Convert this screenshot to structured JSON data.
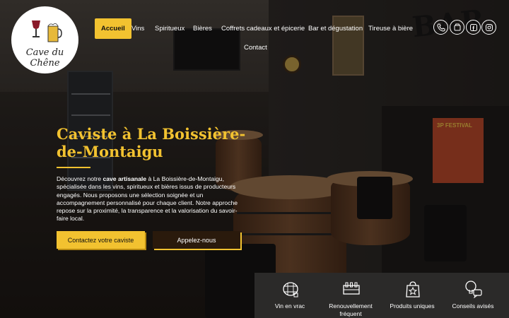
{
  "brand": {
    "name": "Cave du Chêne"
  },
  "nav": {
    "items": [
      {
        "label": "Accueil",
        "active": true
      },
      {
        "label": "Vins"
      },
      {
        "label": "Spiritueux"
      },
      {
        "label": "Bières"
      },
      {
        "label": "Coffrets cadeaux et épicerie"
      },
      {
        "label": "Bar et dégustation"
      },
      {
        "label": "Tireuse à bière"
      },
      {
        "label": "Contact"
      }
    ]
  },
  "social": [
    {
      "icon": "phone-icon"
    },
    {
      "icon": "untappd-icon"
    },
    {
      "icon": "facebook-icon"
    },
    {
      "icon": "instagram-icon"
    }
  ],
  "hero": {
    "title": "Caviste à La Boissière-de-Montaigu",
    "text_before": "Découvrez notre ",
    "text_bold": "cave artisanale",
    "text_after": " à La Boissière-de-Montaigu, spécialisée dans les vins, spiritueux et bières issus de producteurs engagés. Nous proposons une sélection soignée et un accompagnement personnalisé pour chaque client. Notre approche repose sur la proximité, la transparence et la valorisation du savoir-faire local.",
    "primary_button": "Contactez votre caviste",
    "secondary_button": "Appelez-nous"
  },
  "scene": {
    "bar_sign": "BAR",
    "festival_poster": "3P FESTIVAL"
  },
  "features": [
    {
      "icon": "barrel-icon",
      "label": "Vin en vrac"
    },
    {
      "icon": "bottles-crate-icon",
      "label": "Renouvellement fréquent"
    },
    {
      "icon": "star-bag-icon",
      "label": "Produits uniques"
    },
    {
      "icon": "advice-bubble-icon",
      "label": "Conseils avisés"
    }
  ],
  "colors": {
    "accent": "#f2c230",
    "dark_button": "#2a1a0c",
    "strip": "#2b2a29"
  }
}
